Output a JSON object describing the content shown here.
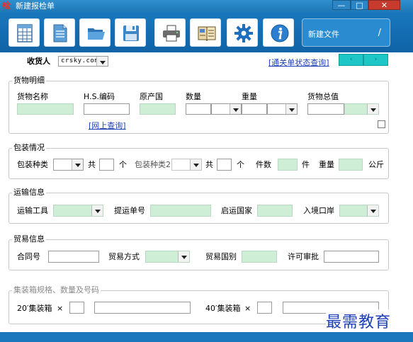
{
  "window": {
    "icon_glyph": "检",
    "title": "新建报检单",
    "minimize": "—",
    "maximize": "□",
    "close": "✕"
  },
  "toolbar": {
    "buttons": [
      "table-icon",
      "document-icon",
      "folder-icon",
      "save-icon",
      "printer-icon",
      "book-icon",
      "gear-icon",
      "info-icon"
    ],
    "newfile_label": "新建文件",
    "newfile_edit": "/"
  },
  "consignee": {
    "label": "收货人",
    "value": "crsky.com",
    "status_link": "[通关单状态查询]",
    "prev": "‹",
    "next": "›"
  },
  "goods": {
    "title": "货物明细",
    "name_label": "货物名称",
    "hs_label": "H.S.编码",
    "origin_label": "原产国",
    "qty_label": "数量",
    "weight_label": "重量",
    "value_label": "货物总值",
    "online_link": "[网上查询]"
  },
  "packing": {
    "title": "包装情况",
    "type_label": "包装种类",
    "total_label": "共",
    "unit_label": "个",
    "type2_label": "包装种类2",
    "total2_label": "共",
    "unit2_label": "个",
    "count_label": "件数",
    "count_unit": "件",
    "weight_label": "重量",
    "weight_unit": "公斤"
  },
  "transport": {
    "title": "运输信息",
    "tool_label": "运输工具",
    "bill_label": "提运单号",
    "departure_label": "启运国家",
    "entry_label": "入境口岸"
  },
  "trade": {
    "title": "贸易信息",
    "contract_label": "合同号",
    "mode_label": "贸易方式",
    "country_label": "贸易国别",
    "license_label": "许可审批"
  },
  "container": {
    "title": "集装箱规格、数量及号码",
    "c20_label": "20′集装箱",
    "c20_x": "×",
    "c40_label": "40′集装箱",
    "c40_x": "×"
  },
  "watermark": "最需教育"
}
